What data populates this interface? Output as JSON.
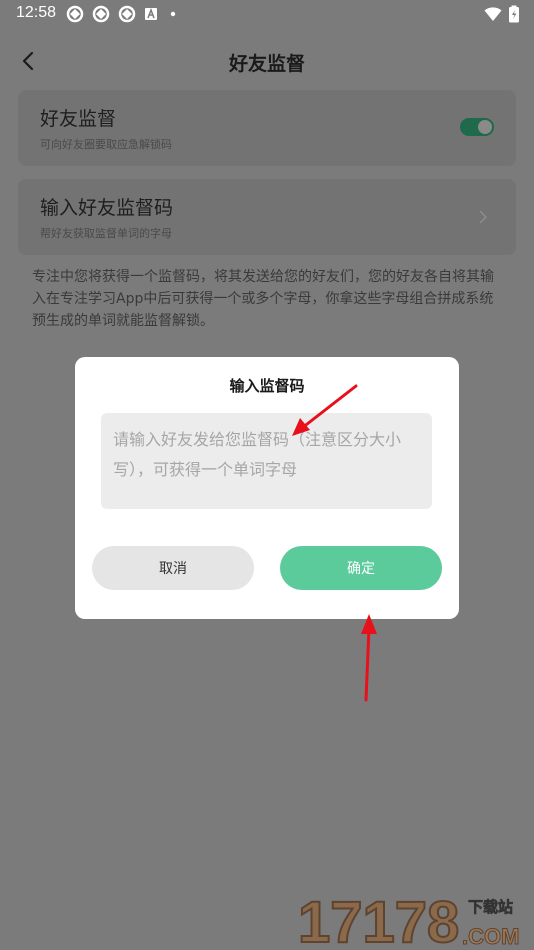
{
  "status_bar": {
    "time": "12:58",
    "notification_icons": [
      "sync-icon",
      "sync-icon",
      "sync-icon",
      "a-icon",
      "dot-icon"
    ],
    "right_icons": [
      "wifi-icon",
      "battery-icon"
    ]
  },
  "header": {
    "title": "好友监督"
  },
  "settings": {
    "supervision": {
      "title": "好友监督",
      "subtitle": "可向好友圈要取应急解锁码",
      "enabled": true
    },
    "enter_code": {
      "title": "输入好友监督码",
      "subtitle": "帮好友获取监督单词的字母"
    }
  },
  "description": "专注中您将获得一个监督码，将其发送给您的好友们，您的好友各自将其输入在专注学习App中后可获得一个或多个字母，你拿这些字母组合拼成系统预生成的单词就能监督解锁。",
  "dialog": {
    "title": "输入监督码",
    "input_value": "",
    "input_placeholder": "请输入好友发给您监督码（注意区分大小写），可获得一个单词字母",
    "cancel_label": "取消",
    "confirm_label": "确定"
  },
  "watermark": {
    "text": "17178",
    "sub_top": "下载站",
    "sub_bottom": ".COM"
  },
  "colors": {
    "accent": "#5ccb9c",
    "toggle_on": "#1e6a4b",
    "overlay_bg": "#7b7b7b",
    "annotation_arrow": "#e8101a"
  }
}
